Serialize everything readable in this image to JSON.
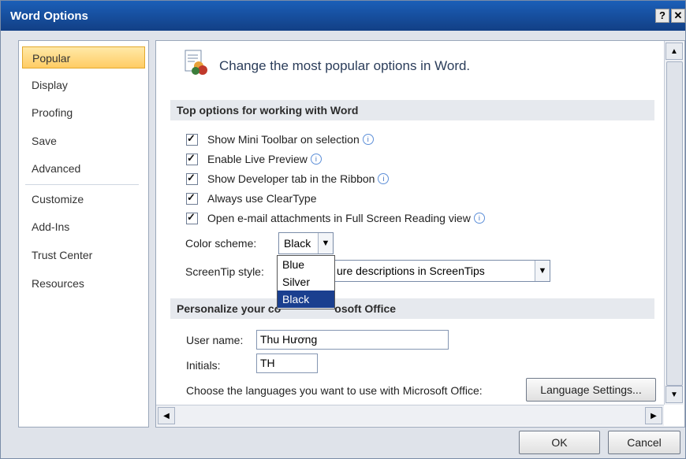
{
  "window": {
    "title": "Word Options",
    "help_glyph": "?",
    "close_glyph": "✕"
  },
  "sidebar": {
    "items": [
      {
        "label": "Popular"
      },
      {
        "label": "Display"
      },
      {
        "label": "Proofing"
      },
      {
        "label": "Save"
      },
      {
        "label": "Advanced"
      },
      {
        "label": "Customize"
      },
      {
        "label": "Add-Ins"
      },
      {
        "label": "Trust Center"
      },
      {
        "label": "Resources"
      }
    ]
  },
  "main": {
    "header": "Change the most popular options in Word.",
    "section1": "Top options for working with Word",
    "options": [
      {
        "label": "Show Mini Toolbar on selection",
        "checked": true,
        "info": true
      },
      {
        "label": "Enable Live Preview",
        "checked": true,
        "info": true
      },
      {
        "label": "Show Developer tab in the Ribbon",
        "checked": true,
        "info": true
      },
      {
        "label": "Always use ClearType",
        "checked": true,
        "info": false
      },
      {
        "label": "Open e-mail attachments in Full Screen Reading view",
        "checked": true,
        "info": true
      }
    ],
    "color_scheme": {
      "label": "Color scheme:",
      "value": "Black",
      "options": [
        "Blue",
        "Silver",
        "Black"
      ]
    },
    "screentip": {
      "label": "ScreenTip style:",
      "value": "ure descriptions in ScreenTips"
    },
    "section2_left": "Personalize your co",
    "section2_right": "osoft Office",
    "user_name": {
      "label": "User name:",
      "value": "Thu Hương"
    },
    "initials": {
      "label": "Initials:",
      "value": "TH"
    },
    "languages": {
      "label": "Choose the languages you want to use with Microsoft Office:",
      "button": "Language Settings..."
    }
  },
  "footer": {
    "ok": "OK",
    "cancel": "Cancel"
  },
  "info_glyph": "i"
}
